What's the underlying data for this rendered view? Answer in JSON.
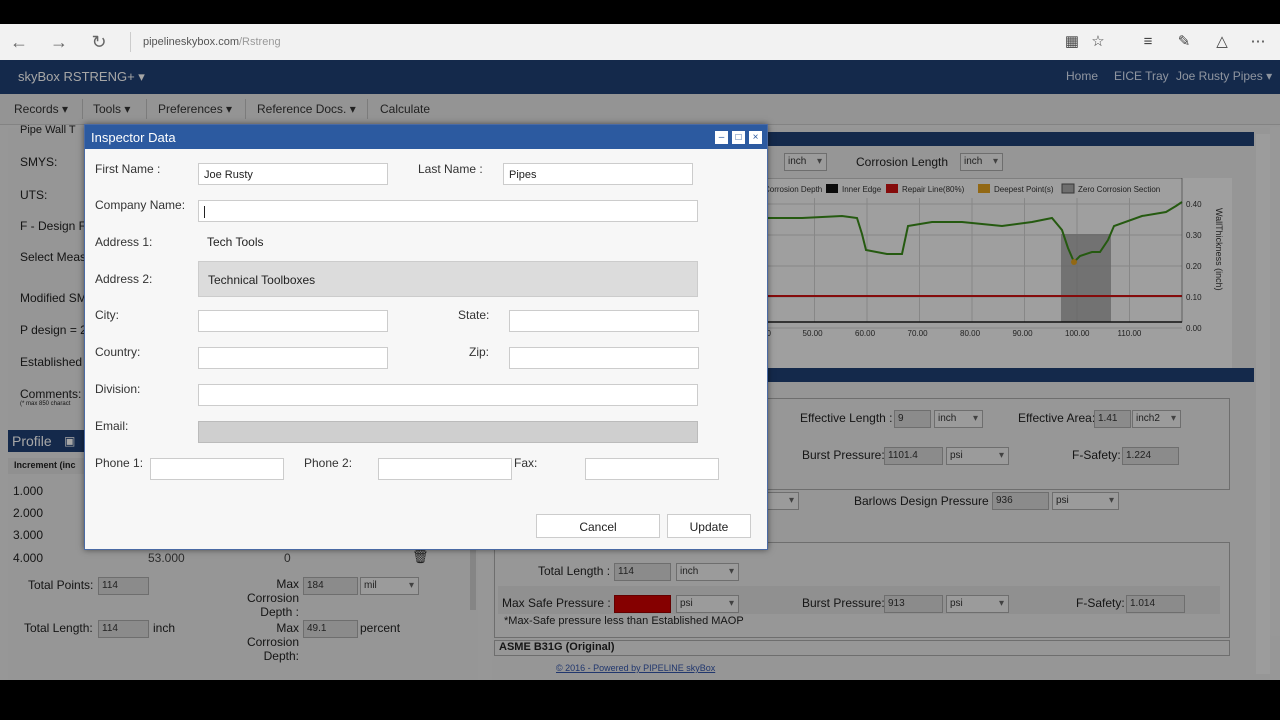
{
  "browser": {
    "url_host": "pipelineskybox.com",
    "url_path": "/Rstreng",
    "icons": [
      "back-icon",
      "forward-icon",
      "refresh-icon",
      "reading-view-icon",
      "favorite-star-icon",
      "hub-icon",
      "web-note-icon",
      "share-icon",
      "more-icon"
    ]
  },
  "app": {
    "brand": "skyBox RSTRENG+",
    "nav_right": [
      "Home",
      "EICE Tray",
      "Joe Rusty Pipes"
    ],
    "menu": [
      "Records",
      "Tools",
      "Preferences",
      "Reference Docs.",
      "Calculate"
    ]
  },
  "left_panel": {
    "labels": [
      "Pipe Wall T",
      "SMYS:",
      "UTS:",
      "F - Design F",
      "Select Meas",
      "Modified SM",
      "P design = 2",
      "Established",
      "Comments:"
    ],
    "comments_hint": "(* max 850 charact",
    "profile_title": "Profile",
    "increment_header": "Increment (inc",
    "increments": [
      "1.000",
      "2.000",
      "3.000",
      "4.000"
    ],
    "row4_value": "53.000",
    "row4_value2": "0",
    "total_points_label": "Total Points:",
    "total_points": "114",
    "max_corr_depth_label": "Max Corrosion Depth :",
    "max_corr_depth": "184",
    "max_corr_depth_unit": "mil",
    "total_length_label": "Total Length:",
    "total_length": "114",
    "total_length_unit": "inch",
    "max_corr_depth2_label": "Max Corrosion Depth:",
    "max_corr_depth2": "49.1",
    "max_corr_depth2_unit": "percent"
  },
  "right_panel": {
    "unit_inch": "inch",
    "corrosion_length_label": "Corrosion Length",
    "legend": [
      "Corrosion Depth",
      "Inner Edge",
      "Repair Line(80%)",
      "Deepest Point(s)",
      "Zero Corrosion Section"
    ],
    "y_ticks": [
      "0.40",
      "0.30",
      "0.20",
      "0.10",
      "0.00"
    ],
    "y_axis_label": "WallThickness (inch)",
    "x_ticks": [
      "00",
      "50.00",
      "60.00",
      "70.00",
      "80.00",
      "90.00",
      "100.00",
      "110.00"
    ],
    "effective_length_label": "Effective Length :",
    "effective_length": "9",
    "effective_length_unit": "inch",
    "effective_area_label": "Effective Area:",
    "effective_area": "1.41",
    "effective_area_unit": "inch2",
    "burst_pressure_label": "Burst Pressure:",
    "burst_pressure": "1101.4",
    "burst_pressure_unit": "psi",
    "f_safety_label": "F-Safety:",
    "f_safety": "1.224",
    "barlows_label": "Barlows Design Pressure",
    "barlows": "936",
    "barlows_unit": "psi",
    "total_length_label": "Total Length :",
    "total_length": "114",
    "total_length_unit": "inch",
    "max_safe_label": "Max Safe Pressure :",
    "max_safe_unit": "psi",
    "burst_pressure2_label": "Burst Pressure:",
    "burst_pressure2": "913",
    "burst_pressure2_unit": "psi",
    "f_safety2_label": "F-Safety:",
    "f_safety2": "1.014",
    "warning": "*Max-Safe pressure less than Established MAOP",
    "asme_title": "ASME B31G (Original)",
    "accent_red": "#cc0000"
  },
  "footer": "© 2016 - Powered by PIPELINE skyBox",
  "modal": {
    "title": "Inspector Data",
    "first_name_label": "First Name :",
    "first_name": "Joe Rusty",
    "last_name_label": "Last Name :",
    "last_name": "Pipes",
    "company_label": "Company Name:",
    "company": "",
    "address1_label": "Address 1:",
    "address1": "Tech Tools",
    "address2_label": "Address 2:",
    "address2": "Technical Toolboxes",
    "city_label": "City:",
    "state_label": "State:",
    "country_label": "Country:",
    "zip_label": "Zip:",
    "division_label": "Division:",
    "email_label": "Email:",
    "phone1_label": "Phone 1:",
    "phone2_label": "Phone 2:",
    "fax_label": "Fax:",
    "cancel": "Cancel",
    "update": "Update"
  }
}
